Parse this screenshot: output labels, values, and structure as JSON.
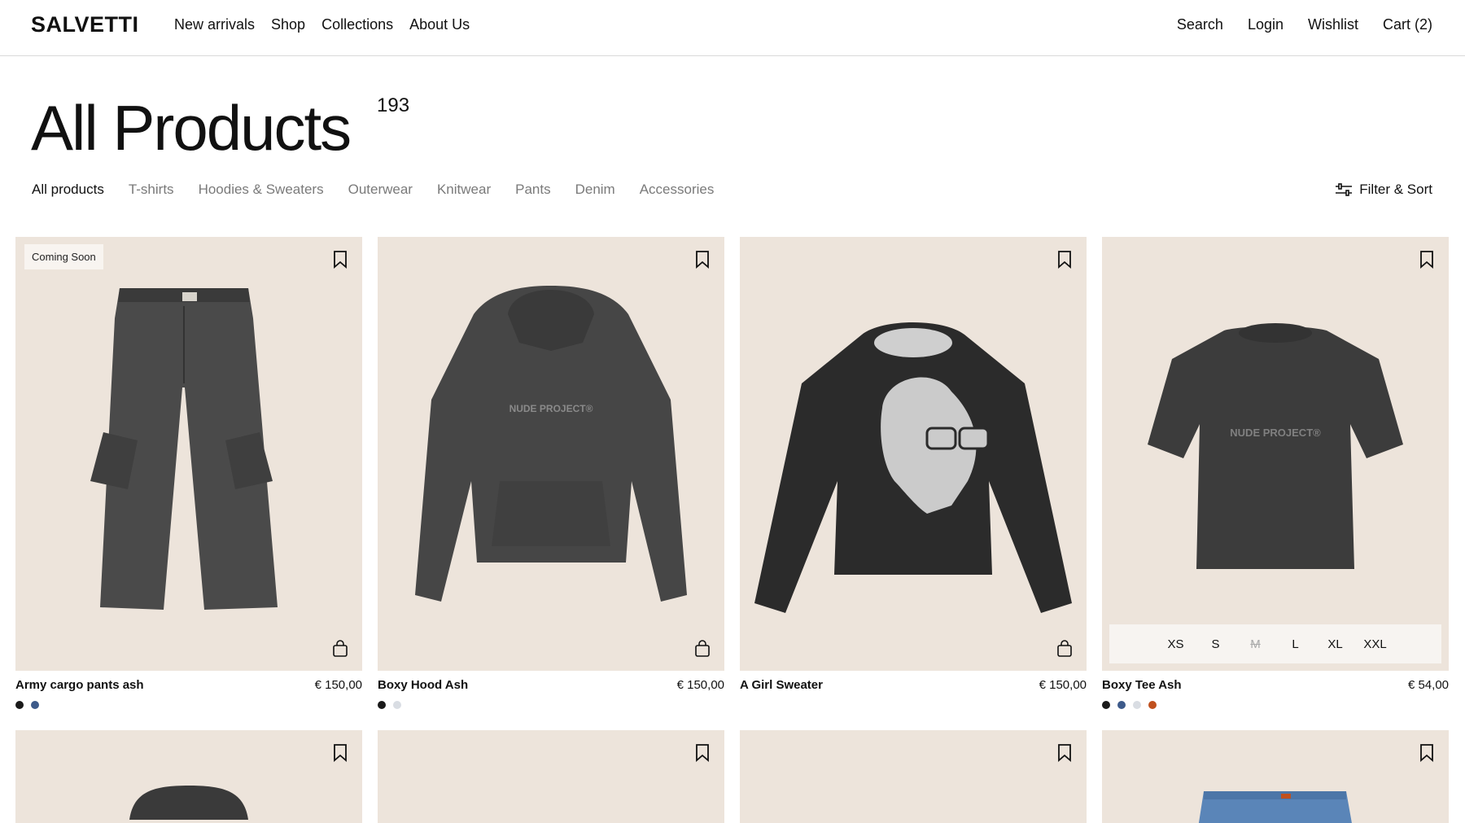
{
  "header": {
    "logo": "SALVETTI",
    "nav": [
      "New arrivals",
      "Shop",
      "Collections",
      "About Us"
    ],
    "right": [
      "Search",
      "Login",
      "Wishlist",
      "Cart (2)"
    ]
  },
  "page": {
    "title": "All Products",
    "count": "193"
  },
  "categories": {
    "items": [
      "All products",
      "T-shirts",
      "Hoodies & Sweaters",
      "Outerwear",
      "Knitwear",
      "Pants",
      "Denim",
      "Accessories"
    ],
    "active": "All products"
  },
  "filter_label": "Filter & Sort",
  "products": [
    {
      "name": "Army cargo pants ash",
      "price": "€ 150,00",
      "badge": "Coming Soon",
      "swatches": [
        "#1a1a1a",
        "#3d5a8a"
      ]
    },
    {
      "name": "Boxy Hood Ash",
      "price": "€ 150,00",
      "print": "NUDE PROJECT®",
      "swatches": [
        "#1a1a1a",
        "#d9dde3"
      ]
    },
    {
      "name": "A Girl Sweater",
      "price": "€ 150,00",
      "swatches": []
    },
    {
      "name": "Boxy Tee Ash",
      "price": "€ 54,00",
      "print": "NUDE PROJECT®",
      "sizes": [
        "XS",
        "S",
        "M",
        "L",
        "XL",
        "XXL"
      ],
      "size_unavailable": "M",
      "swatches": [
        "#1a1a1a",
        "#3d5a8a",
        "#d9dde3",
        "#c0501e"
      ]
    }
  ],
  "colors": {
    "card_bg": "#ede4db",
    "divider": "#d9d9d9",
    "muted_text": "#7a7a7a"
  }
}
